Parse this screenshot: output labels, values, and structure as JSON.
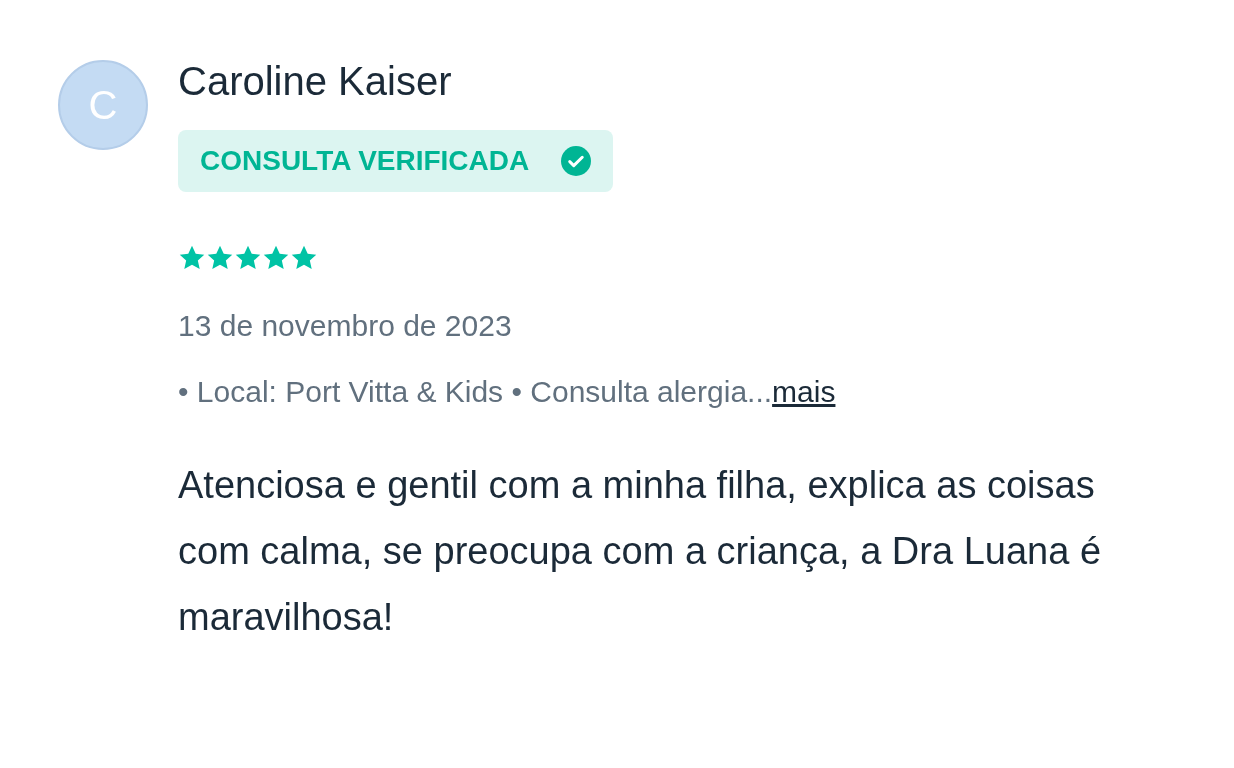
{
  "review": {
    "avatar_letter": "C",
    "author": "Caroline Kaiser",
    "badge": {
      "label": "CONSULTA VERIFICADA",
      "verified": true
    },
    "stars": 5,
    "date": "13 de novembro de 2023",
    "meta": "• Local: Port Vitta & Kids • Consulta alergia...",
    "more_link": "mais",
    "text": "Atenciosa e gentil com a minha filha, explica as coisas com calma, se preocupa com a criança, a Dra Luana é maravilhosa!"
  }
}
